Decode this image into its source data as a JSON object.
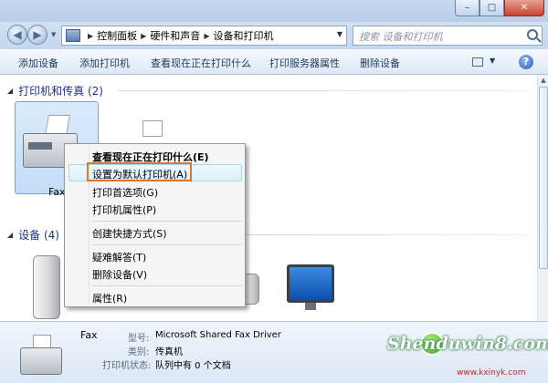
{
  "window": {
    "buttons": {
      "minimize": "–",
      "maximize": "□",
      "close": "✕"
    }
  },
  "navbar": {
    "breadcrumbs": [
      "控制面板",
      "硬件和声音",
      "设备和打印机"
    ],
    "search_placeholder": "搜索 设备和打印机"
  },
  "toolbar": {
    "items": [
      "添加设备",
      "添加打印机",
      "查看现在正在打印什么",
      "打印服务器属性",
      "删除设备"
    ],
    "help": "?"
  },
  "groups": {
    "printers": {
      "title": "打印机和传真 (2)"
    },
    "devices": {
      "title": "设备 (4)"
    }
  },
  "selected_device": {
    "label": "Fax"
  },
  "context_menu": {
    "items": [
      {
        "label": "查看现在正在打印什么(E)",
        "bold": true
      },
      {
        "label": "设置为默认打印机(A)",
        "highlighted": true
      },
      {
        "label": "打印首选项(G)"
      },
      {
        "label": "打印机属性(P)"
      },
      {
        "label": "创建快捷方式(S)"
      },
      {
        "label": "疑难解答(T)"
      },
      {
        "label": "删除设备(V)"
      },
      {
        "label": "属性(R)"
      }
    ]
  },
  "details": {
    "name": "Fax",
    "model_label": "型号:",
    "model_value": "Microsoft Shared Fax Driver",
    "category_label": "类别:",
    "category_value": "传真机",
    "status_label": "打印机状态:",
    "status_value": "队列中有 0 个文档"
  },
  "watermark": {
    "text": "Shenduwin8.com",
    "site": "www.kxinyk.com"
  },
  "colors": {
    "accent_outline": "#e0762c",
    "selection": "#c3dcf6",
    "group_title": "#1e3287"
  }
}
